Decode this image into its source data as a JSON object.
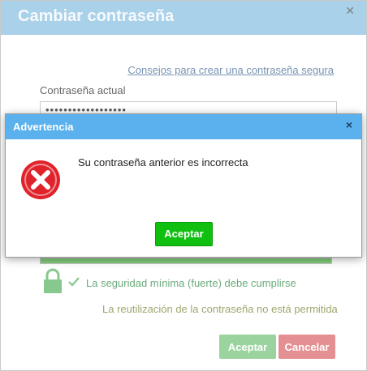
{
  "dialog": {
    "title": "Cambiar contraseña",
    "close_icon": "close-icon",
    "tips_link": "Consejos para crear una contraseña segura",
    "current_password_label": "Contraseña actual",
    "current_password_value": "••••••••••••••••••",
    "strength_level_percent": 100,
    "rules": {
      "min_security": "La seguridad mínima (fuerte) debe cumplirse",
      "no_reuse": "La reutilización de la contraseña no está permitida"
    },
    "buttons": {
      "accept": "Aceptar",
      "cancel": "Cancelar"
    }
  },
  "warning": {
    "title": "Advertencia",
    "close_symbol": "×",
    "message": "Su contraseña anterior es incorrecta",
    "accept": "Aceptar",
    "icon": "error-icon"
  },
  "colors": {
    "header": "#8dc2e3",
    "modal_header": "#5ab1ee",
    "accept_green": "#10c010",
    "success": "#57b94e",
    "cancel_red": "#db6b6f",
    "error_red": "#e0222a"
  }
}
